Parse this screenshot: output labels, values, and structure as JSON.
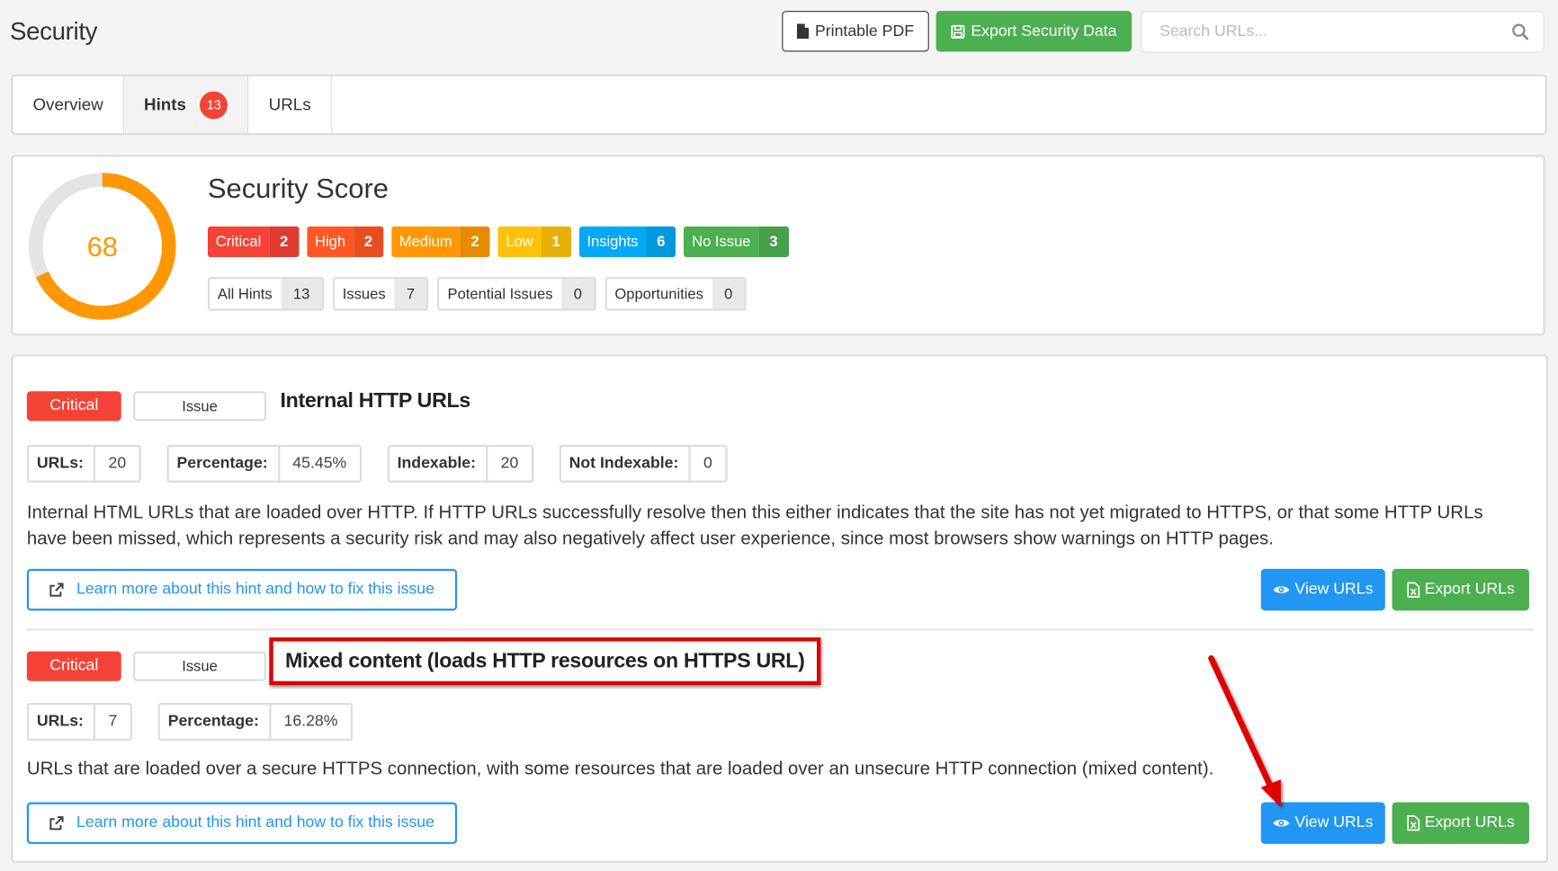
{
  "page": {
    "title": "Security"
  },
  "toolbar": {
    "pdf_label": "Printable PDF",
    "export_label": "Export Security Data",
    "search_placeholder": "Search URLs...",
    "search_value": ""
  },
  "tabs": [
    {
      "label": "Overview",
      "active": false
    },
    {
      "label": "Hints",
      "active": true,
      "badge": "13"
    },
    {
      "label": "URLs",
      "active": false
    }
  ],
  "score": {
    "title": "Security Score",
    "value": "68",
    "fraction": 0.68,
    "color": "#ff9800",
    "track_color": "#e4e4e4",
    "severities": [
      {
        "label": "Critical",
        "count": "2",
        "color": "#f44336",
        "dark": "#df3b30"
      },
      {
        "label": "High",
        "count": "2",
        "color": "#ff5722",
        "dark": "#e84e1f"
      },
      {
        "label": "Medium",
        "count": "2",
        "color": "#ff9800",
        "dark": "#e88a00"
      },
      {
        "label": "Low",
        "count": "1",
        "color": "#ffc107",
        "dark": "#e8b006"
      },
      {
        "label": "Insights",
        "count": "6",
        "color": "#03a9f4",
        "dark": "#0399de"
      },
      {
        "label": "No Issue",
        "count": "3",
        "color": "#4caf50",
        "dark": "#45a049"
      }
    ],
    "counts": [
      {
        "label": "All Hints",
        "count": "13"
      },
      {
        "label": "Issues",
        "count": "7"
      },
      {
        "label": "Potential Issues",
        "count": "0"
      },
      {
        "label": "Opportunities",
        "count": "0"
      }
    ]
  },
  "hints": [
    {
      "severity": "Critical",
      "type": "Issue",
      "title": "Internal HTTP URLs",
      "highlighted": false,
      "stats": [
        {
          "key": "URLs:",
          "value": "20"
        },
        {
          "key": "Percentage:",
          "value": "45.45%"
        },
        {
          "key": "Indexable:",
          "value": "20"
        },
        {
          "key": "Not Indexable:",
          "value": "0"
        }
      ],
      "description": "Internal HTML URLs that are loaded over HTTP. If HTTP URLs successfully resolve then this either indicates that the site has not yet migrated to HTTPS, or that some HTTP URLs have been missed, which represents a security risk and may also negatively affect user experience, since most browsers show warnings on HTTP pages.",
      "learn_label": "Learn more about this hint and how to fix this issue",
      "view_label": "View URLs",
      "export_label": "Export URLs"
    },
    {
      "severity": "Critical",
      "type": "Issue",
      "title": "Mixed content (loads HTTP resources on HTTPS URL)",
      "highlighted": true,
      "stats": [
        {
          "key": "URLs:",
          "value": "7"
        },
        {
          "key": "Percentage:",
          "value": "16.28%"
        }
      ],
      "description": "URLs that are loaded over a secure HTTPS connection, with some resources that are loaded over an unsecure HTTP connection (mixed content).",
      "learn_label": "Learn more about this hint and how to fix this issue",
      "view_label": "View URLs",
      "export_label": "Export URLs"
    }
  ]
}
